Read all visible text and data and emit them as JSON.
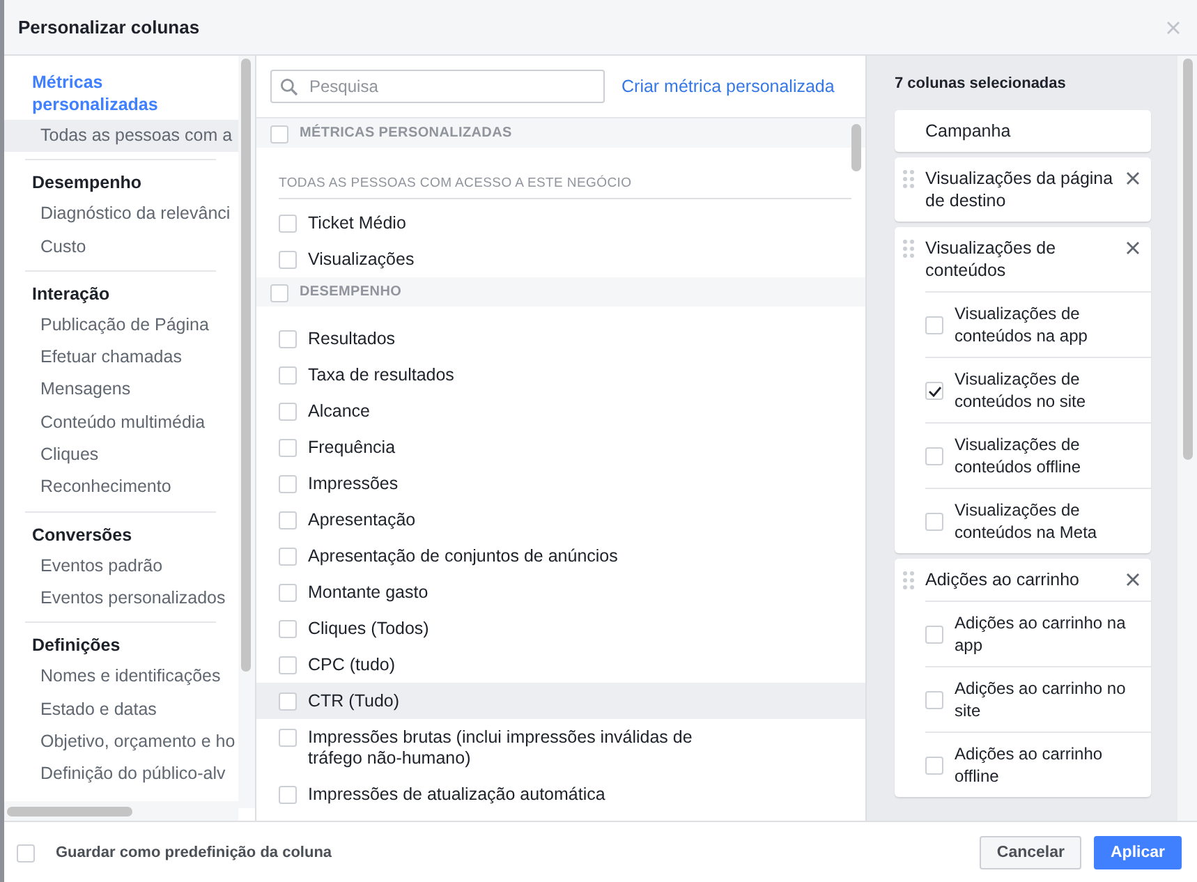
{
  "window": {
    "title": "Personalizar colunas"
  },
  "sidebar": {
    "groups": [
      {
        "title": "Métricas personalizadas",
        "selected": true,
        "items": [
          {
            "label": "Todas as pessoas com a",
            "selected": true
          }
        ]
      },
      {
        "title": "Desempenho",
        "selected": false,
        "items": [
          {
            "label": "Diagnóstico da relevânci",
            "selected": false
          },
          {
            "label": "Custo",
            "selected": false
          }
        ]
      },
      {
        "title": "Interação",
        "selected": false,
        "items": [
          {
            "label": "Publicação de Página",
            "selected": false
          },
          {
            "label": "Efetuar chamadas",
            "selected": false
          },
          {
            "label": "Mensagens",
            "selected": false
          },
          {
            "label": "Conteúdo multimédia",
            "selected": false
          },
          {
            "label": "Cliques",
            "selected": false
          },
          {
            "label": "Reconhecimento",
            "selected": false
          }
        ]
      },
      {
        "title": "Conversões",
        "selected": false,
        "items": [
          {
            "label": "Eventos padrão",
            "selected": false
          },
          {
            "label": "Eventos personalizados",
            "selected": false
          }
        ]
      },
      {
        "title": "Definições",
        "selected": false,
        "items": [
          {
            "label": "Nomes e identificações",
            "selected": false
          },
          {
            "label": "Estado e datas",
            "selected": false
          },
          {
            "label": "Objetivo, orçamento e ho",
            "selected": false
          },
          {
            "label": "Definição do público-alv",
            "selected": false
          }
        ]
      }
    ]
  },
  "search": {
    "placeholder": "Pesquisa"
  },
  "create_link": "Criar métrica personalizada",
  "sections": [
    {
      "title": "MÉTRICAS PERSONALIZADAS",
      "checked": false,
      "subheading": "TODAS AS PESSOAS COM ACESSO A ESTE NEGÓCIO",
      "items": [
        {
          "label": "Ticket Médio",
          "checked": false,
          "highlighted": false
        },
        {
          "label": "Visualizações",
          "checked": false,
          "highlighted": false
        }
      ]
    },
    {
      "title": "DESEMPENHO",
      "checked": false,
      "items": [
        {
          "label": "Resultados",
          "checked": false,
          "highlighted": false
        },
        {
          "label": "Taxa de resultados",
          "checked": false,
          "highlighted": false
        },
        {
          "label": "Alcance",
          "checked": false,
          "highlighted": false
        },
        {
          "label": "Frequência",
          "checked": false,
          "highlighted": false
        },
        {
          "label": "Impressões",
          "checked": false,
          "highlighted": false
        },
        {
          "label": "Apresentação",
          "checked": false,
          "highlighted": false
        },
        {
          "label": "Apresentação de conjuntos de anúncios",
          "checked": false,
          "highlighted": false
        },
        {
          "label": "Montante gasto",
          "checked": false,
          "highlighted": false
        },
        {
          "label": "Cliques (Todos)",
          "checked": false,
          "highlighted": false
        },
        {
          "label": "CPC (tudo)",
          "checked": false,
          "highlighted": false
        },
        {
          "label": "CTR (Tudo)",
          "checked": false,
          "highlighted": true
        },
        {
          "label": "Impressões brutas (inclui impressões inválidas de tráfego não-humano)",
          "checked": false,
          "highlighted": false
        },
        {
          "label": "Impressões de atualização automática",
          "checked": false,
          "highlighted": false
        }
      ]
    }
  ],
  "selected_panel": {
    "heading": "7 colunas selecionadas",
    "columns": [
      {
        "label": "Campanha",
        "removable": false
      },
      {
        "label": "Visualizações da página de destino",
        "removable": true
      },
      {
        "label": "Visualizações de conteúdos",
        "removable": true,
        "options": [
          {
            "label": "Visualizações de conteúdos na app",
            "checked": false
          },
          {
            "label": "Visualizações de conteúdos no site",
            "checked": true
          },
          {
            "label": "Visualizações de conteúdos offline",
            "checked": false
          },
          {
            "label": "Visualizações de conteúdos na Meta",
            "checked": false
          }
        ]
      },
      {
        "label": "Adições ao carrinho",
        "removable": true,
        "options": [
          {
            "label": "Adições ao carrinho na app",
            "checked": false
          },
          {
            "label": "Adições ao carrinho no site",
            "checked": false
          },
          {
            "label": "Adições ao carrinho offline",
            "checked": false
          }
        ]
      }
    ]
  },
  "footer": {
    "save_default": {
      "label": "Guardar como predefinição da coluna",
      "checked": false
    },
    "buttons": [
      {
        "label": "Cancelar",
        "kind": "secondary"
      },
      {
        "label": "Aplicar",
        "kind": "primary"
      }
    ]
  }
}
